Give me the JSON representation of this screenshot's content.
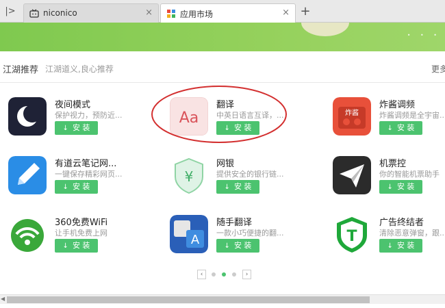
{
  "browser": {
    "tabs": [
      {
        "title": "niconico",
        "icon": "tv-icon",
        "active": false
      },
      {
        "title": "应用市场",
        "icon": "app-grid-icon",
        "active": true
      }
    ],
    "sidebar_toggle_glyph": "|>",
    "close_glyph": "×",
    "new_tab_glyph": "+"
  },
  "banner": {
    "dots": "• • •"
  },
  "section": {
    "title": "江湖推荐",
    "subtitle": "江湖道义,良心推荐",
    "more": "更多"
  },
  "install_label": "安 装",
  "install_icon": "↓",
  "apps": [
    {
      "name": "夜间模式",
      "desc": "保护视力，预防近...",
      "icon": "moon-icon",
      "color": "#1f2236"
    },
    {
      "name": "翻译",
      "desc": "中英日语言互译，...",
      "icon": "translate-aa-icon",
      "color": "#f7dede",
      "icon_text": "Aa"
    },
    {
      "name": "炸酱调频",
      "desc": "炸酱调频是全宇宙...",
      "icon": "radio-icon",
      "color": "#e8503a",
      "icon_text": "炸酱"
    },
    {
      "name": "有道云笔记网...",
      "desc": "一键保存精彩网页...",
      "icon": "pen-note-icon",
      "color": "#2a8de6"
    },
    {
      "name": "网银",
      "desc": "提供安全的银行链...",
      "icon": "yuan-shield-icon",
      "color": "#d9f2e2",
      "icon_text": "¥"
    },
    {
      "name": "机票控",
      "desc": "你的智能机票助手",
      "icon": "paper-plane-icon",
      "color": "#2b2b2b"
    },
    {
      "name": "360免费WiFi",
      "desc": "让手机免费上网",
      "icon": "wifi-icon",
      "color": "#3aa83a"
    },
    {
      "name": "随手翻译",
      "desc": "一款小巧便捷的翻...",
      "icon": "translate-a-icon",
      "color": "#2a5fb8",
      "icon_text": "A"
    },
    {
      "name": "广告终结者",
      "desc": "清除恶意弹窗，跟...",
      "icon": "t-shield-icon",
      "color": "#1fa83a",
      "icon_text": "T"
    }
  ],
  "pager": {
    "prev": "‹",
    "next": "›",
    "pages": 4,
    "current": 2
  },
  "scrollbar": {
    "left_arrow": "◀"
  }
}
